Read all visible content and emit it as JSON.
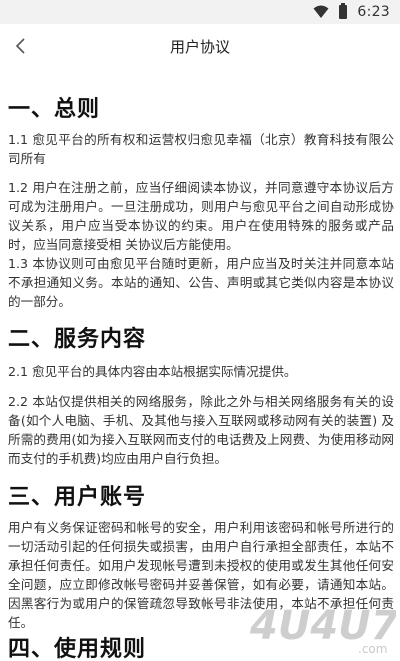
{
  "status_bar": {
    "time": "6:23",
    "icons": [
      "wifi-icon",
      "battery-icon"
    ]
  },
  "header": {
    "title": "用户协议",
    "back_icon": "chevron-left-icon"
  },
  "sections": [
    {
      "heading": "一、总则",
      "paragraphs": [
        "1.1 愈见平台的所有权和运营权归愈见幸福（北京）教育科技有限公司所有",
        "1.2 用户在注册之前，应当仔细阅读本协议，并同意遵守本协议后方可成为注册用户。一旦注册成功，则用户与愈见平台之间自动形成协议关系，用户应当受本协议的约束。用户在使用特殊的服务或产品时，应当同意接受相 关协议后方能使用。",
        "1.3 本协议则可由愈见平台随时更新，用户应当及时关注并同意本站不承担通知义务。本站的通知、公告、声明或其它类似内容是本协议的一部分。"
      ]
    },
    {
      "heading": "二、服务内容",
      "paragraphs": [
        "2.1 愈见平台的具体内容由本站根据实际情况提供。",
        "2.2 本站仅提供相关的网络服务，除此之外与相关网络服务有关的设备(如个人电脑、手机、及其他与接入互联网或移动网有关的装置) 及所需的费用(如为接入互联网而支付的电话费及上网费、为使用移动网而支付的手机费)均应由用户自行负担。"
      ]
    },
    {
      "heading": "三、用户账号",
      "paragraphs": [
        "用户有义务保证密码和帐号的安全，用户利用该密码和帐号所进行的一切活动引起的任何损失或损害，由用户自行承担全部责任，本站不承担任何责任。如用户发现帐号遭到未授权的使用或发生其他任何安全问题，应立即修改帐号密码并妥善保管，如有必要，请通知本站。因黑客行为或用户的保管疏忽导致帐号非法使用，本站不承担任何责任。"
      ]
    },
    {
      "heading": "四、使用规则",
      "paragraphs": []
    }
  ],
  "watermark": {
    "text": "4U4U7",
    "subtext": ".com"
  },
  "colors": {
    "status_bar_bg": "#f2f2f2",
    "text": "#333333",
    "heading": "#111111",
    "watermark": "#c9c9c9"
  }
}
